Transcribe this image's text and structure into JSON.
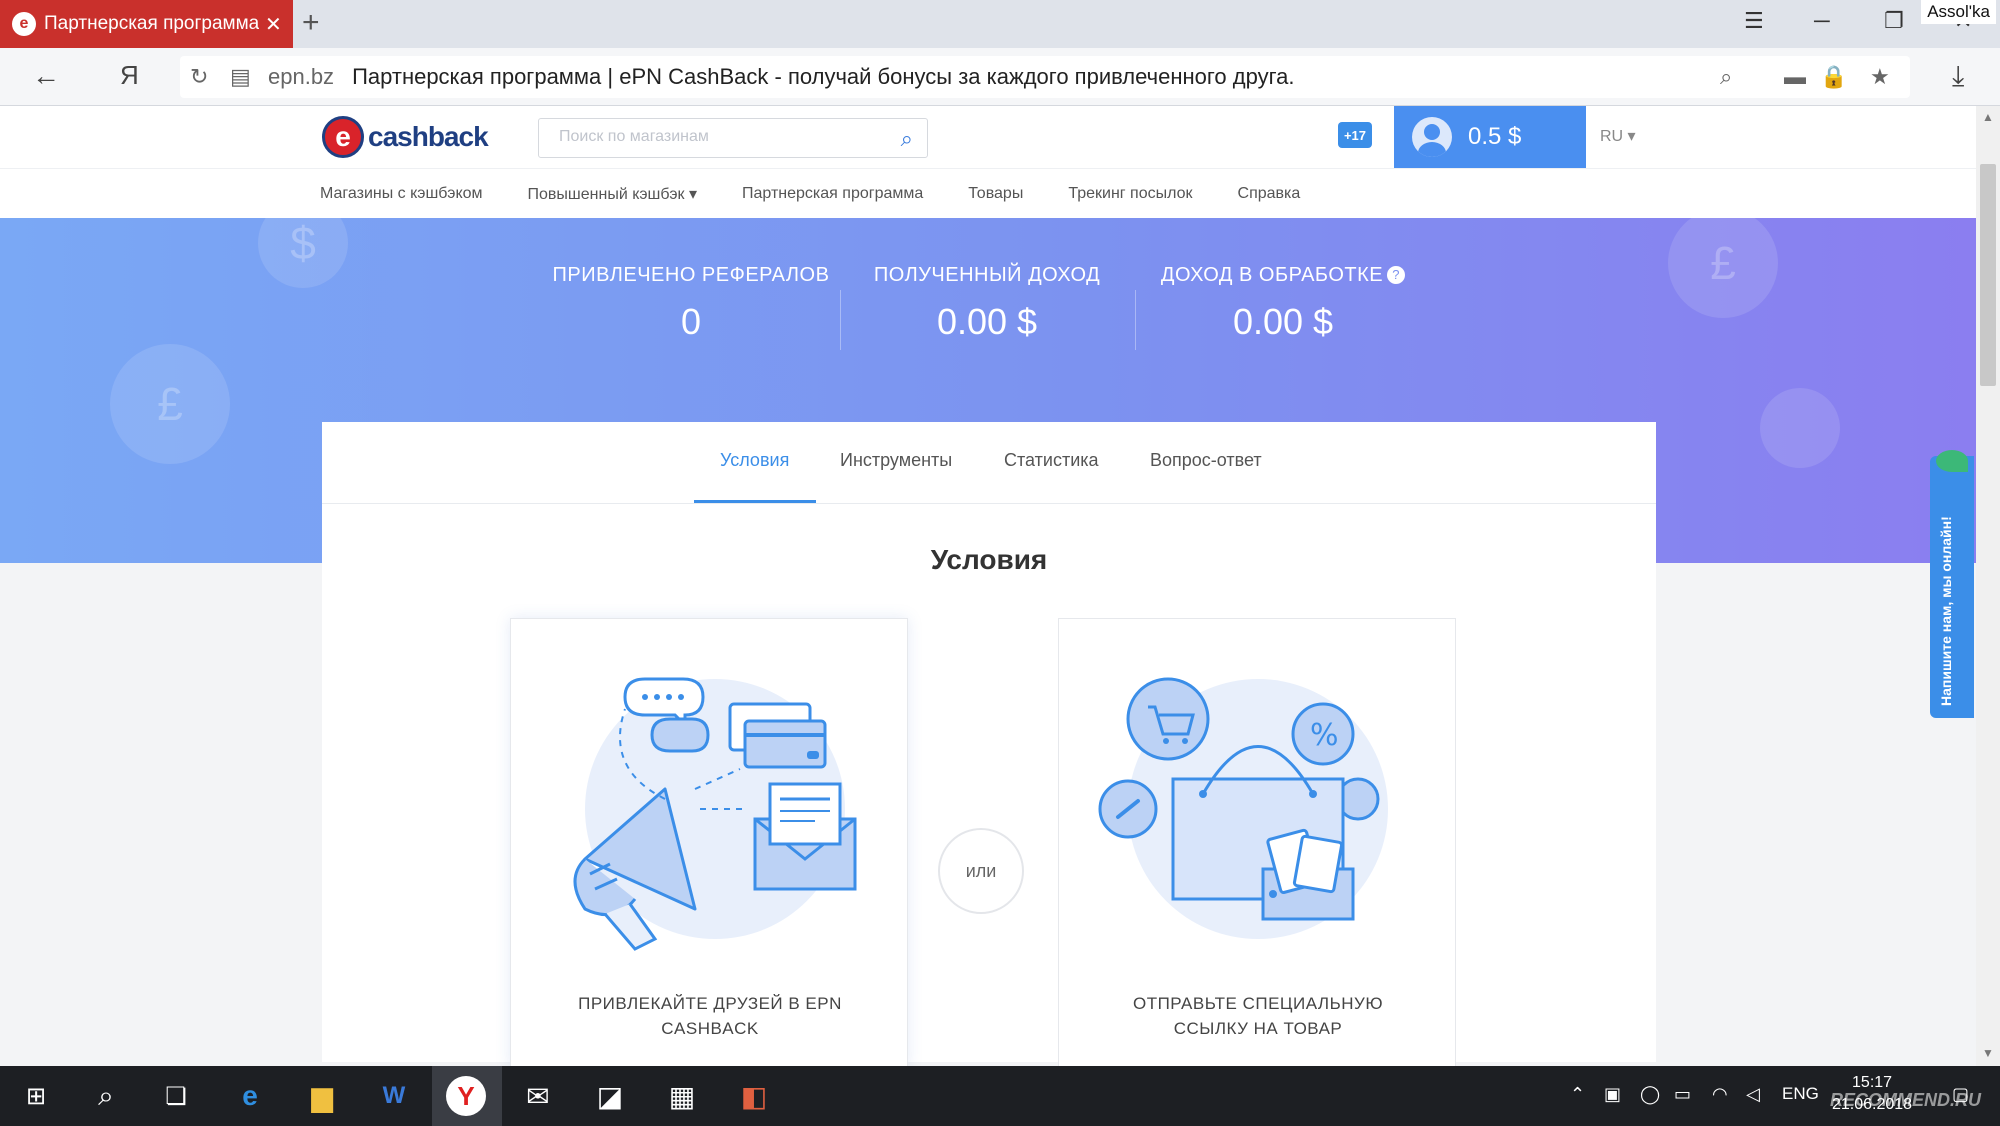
{
  "browser": {
    "tab_title": "Партнерская программа",
    "tab_close": "✕",
    "new_tab": "+",
    "user_label": "Assol'ka",
    "url_domain": "epn.bz",
    "url_title": "Партнерская программа | ePN CashBack - получай бонусы за каждого привлеченного друга.",
    "yandex_btn": "Я"
  },
  "header": {
    "logo_letter": "e",
    "logo_text": "cashback",
    "search_placeholder": "Поиск по магазинам",
    "notif_badge": "+17",
    "balance": "0.5 $",
    "lang": "RU"
  },
  "menu": {
    "items": [
      {
        "label": "Магазины с кэшбэком"
      },
      {
        "label": "Повышенный кэшбэк ▾"
      },
      {
        "label": "Партнерская программа"
      },
      {
        "label": "Товары"
      },
      {
        "label": "Трекинг посылок"
      },
      {
        "label": "Справка"
      }
    ]
  },
  "stats": [
    {
      "label": "ПРИВЛЕЧЕНО РЕФЕРАЛОВ",
      "value": "0"
    },
    {
      "label": "ПОЛУЧЕННЫЙ ДОХОД",
      "value": "0.00 $"
    },
    {
      "label": "ДОХОД В ОБРАБОТКЕ",
      "value": "0.00 $",
      "help": "?"
    }
  ],
  "content": {
    "tabs": [
      {
        "label": "Условия",
        "active": true
      },
      {
        "label": "Инструменты"
      },
      {
        "label": "Статистика"
      },
      {
        "label": "Вопрос-ответ"
      }
    ],
    "title": "Условия",
    "option_left": "ПРИВЛЕКАЙТЕ ДРУЗЕЙ В EPN CASHBACK",
    "or_label": "или",
    "option_right": "ОТПРАВЬТЕ СПЕЦИАЛЬНУЮ ССЫЛКУ НА ТОВАР"
  },
  "chat_widget": {
    "label": "Напишите нам, мы онлайн!"
  },
  "taskbar": {
    "lang": "ENG",
    "time": "15:17",
    "date": "21.06.2018",
    "watermark": "RECOMMEND.RU"
  },
  "colors": {
    "brand_red": "#c9302c",
    "accent_blue": "#3b8ee8",
    "hero_start": "#7aa8f5",
    "hero_end": "#8b7ef0"
  }
}
